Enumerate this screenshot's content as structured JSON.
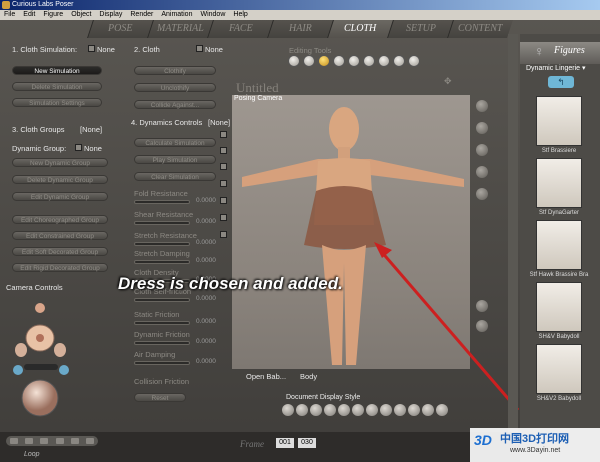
{
  "app": {
    "title": "Curious Labs Poser"
  },
  "menu": [
    "File",
    "Edit",
    "Figure",
    "Object",
    "Display",
    "Render",
    "Animation",
    "Window",
    "Help"
  ],
  "tabs": [
    "POSE",
    "MATERIAL",
    "FACE",
    "HAIR",
    "CLOTH",
    "SETUP",
    "CONTENT"
  ],
  "active_tab": "CLOTH",
  "cloth_simulation": {
    "label": "1. Cloth Simulation:",
    "value": "None",
    "buttons": [
      "New Simulation",
      "Delete Simulation",
      "Simulation Settings"
    ]
  },
  "cloth": {
    "label": "2. Cloth",
    "value": "None",
    "buttons": [
      "Clothify",
      "Unclothify",
      "Collide Against..."
    ]
  },
  "cloth_groups": {
    "label": "3. Cloth Groups",
    "value": "[None]",
    "dyn_label": "Dynamic Group:",
    "dyn_value": "None",
    "buttons": [
      "New Dynamic Group",
      "Delete Dynamic Group",
      "Edit Dynamic Group",
      "Edit Choreographed Group",
      "Edit Constrained Group",
      "Edit Soft Decorated Group",
      "Edit Rigid Decorated Group"
    ]
  },
  "dynamics": {
    "label": "4. Dynamics Controls",
    "value": "[None]",
    "buttons": [
      "Calculate Simulation",
      "Play Simulation",
      "Clear Simulation"
    ],
    "params": [
      {
        "label": "Fold Resistance",
        "value": "0.0000"
      },
      {
        "label": "Shear Resistance",
        "value": "0.0000"
      },
      {
        "label": "Stretch Resistance",
        "value": "0.0000"
      },
      {
        "label": "Stretch Damping",
        "value": "0.0000"
      },
      {
        "label": "Cloth Density",
        "value": "0.0000"
      },
      {
        "label": "Cloth Self-friction",
        "value": "0.0000"
      },
      {
        "label": "Static Friction",
        "value": "0.0000"
      },
      {
        "label": "Dynamic Friction",
        "value": "0.0000"
      },
      {
        "label": "Air Damping",
        "value": "0.0000"
      }
    ],
    "collision_friction": "Collision Friction",
    "reset": "Reset"
  },
  "camera_controls": "Camera Controls",
  "editing_tools_label": "Editing Tools",
  "document": {
    "title": "Untitled",
    "camera": "Posing Camera",
    "bottom_left": "Open Bab...",
    "bottom_right": "Body"
  },
  "caption": "Dress is chosen and added.",
  "document_display_style": "Document Display Style",
  "figures_panel": {
    "title": "Figures",
    "category": "Dynamic Lingerie",
    "items": [
      "Stf Brassiere",
      "Stf DynaGarter",
      "Stf Hawk Brassire Bra",
      "SH&V Babydoll",
      "SH&V2 Babydoll"
    ]
  },
  "timeline": {
    "frame_label": "Frame",
    "current": "001",
    "total": "030",
    "loop": "Loop"
  },
  "watermark": {
    "logo": "3D",
    "name": "中国3D打印网",
    "url": "www.3Dayin.net"
  }
}
